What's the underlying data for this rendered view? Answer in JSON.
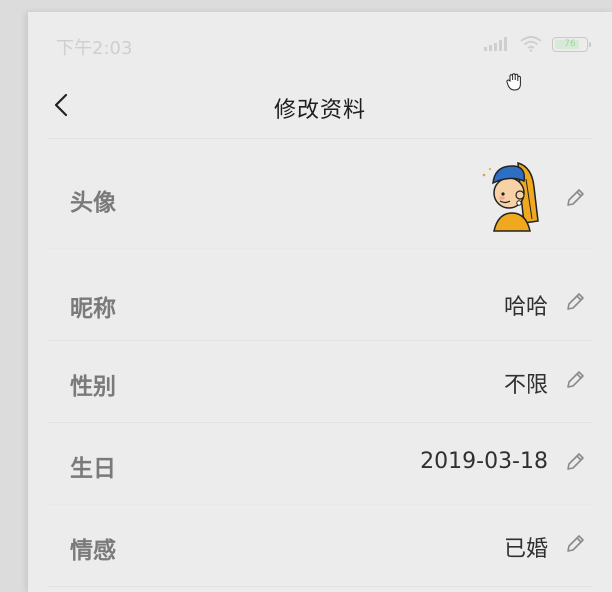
{
  "status": {
    "time": "下午2:03",
    "battery": "76"
  },
  "header": {
    "title": "修改资料"
  },
  "rows": [
    {
      "label": "头像",
      "value": ""
    },
    {
      "label": "昵称",
      "value": "哈哈"
    },
    {
      "label": "性别",
      "value": "不限"
    },
    {
      "label": "生日",
      "value": "2019-03-18"
    },
    {
      "label": "情感",
      "value": "已婚"
    }
  ],
  "icons": {
    "back": "chevron-left-icon",
    "edit": "pencil-icon",
    "signal": "signal-icon",
    "wifi": "wifi-icon",
    "battery": "battery-icon",
    "cursor": "hand-cursor-icon"
  }
}
